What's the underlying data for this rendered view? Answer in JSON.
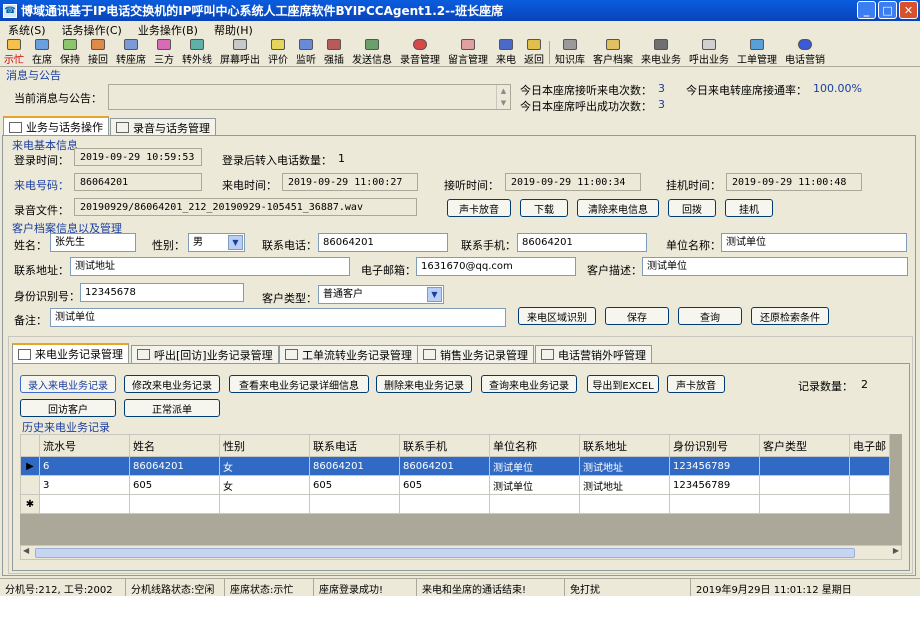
{
  "window": {
    "title": "博域通讯基于IP电话交换机的IP呼叫中心系统人工座席软件BYIPCCAgent1.2--班长座席"
  },
  "menu": [
    "系统(S)",
    "话务操作(C)",
    "业务操作(B)",
    "帮助(H)"
  ],
  "toolbar": [
    "示忙",
    "在席",
    "保持",
    "接回",
    "转座席",
    "三方",
    "转外线",
    "屏幕呼出",
    "评价",
    "监听",
    "强插",
    "发送信息",
    "录音管理",
    "留言管理",
    "来电",
    "返回",
    "知识库",
    "客户档案",
    "来电业务",
    "呼出业务",
    "工单管理",
    "电话营销"
  ],
  "notice": {
    "section_label": "消息与公告",
    "current_label": "当前消息与公告：",
    "current_value": "",
    "stats": [
      {
        "label": "今日本座席接听来电次数：",
        "value": "3"
      },
      {
        "label": "今日来电转座席接通率：",
        "value": "100.00%"
      },
      {
        "label": "今日本座席呼出成功次数：",
        "value": "3"
      }
    ]
  },
  "main_tabs": [
    "业务与话务操作",
    "录音与话务管理"
  ],
  "call_info": {
    "section_label": "来电基本信息",
    "login_time_label": "登录时间：",
    "login_time": "2019-09-29 10:59:53",
    "transfer_count_label": "登录后转入电话数量：",
    "transfer_count": "1",
    "caller_label": "来电号码：",
    "caller": "86064201",
    "incoming_time_label": "来电时间：",
    "incoming_time": "2019-09-29 11:00:27",
    "answer_time_label": "接听时间：",
    "answer_time": "2019-09-29 11:00:34",
    "hangup_time_label": "挂机时间：",
    "hangup_time": "2019-09-29 11:00:48",
    "recording_label": "录音文件：",
    "recording_file": "20190929/86064201_212_20190929-105451_36887.wav",
    "buttons": [
      "声卡放音",
      "下载",
      "清除来电信息",
      "回拨",
      "挂机"
    ]
  },
  "customer": {
    "section_label": "客户档案信息以及管理",
    "name_label": "姓名：",
    "name": "张先生",
    "gender_label": "性别：",
    "gender": "男",
    "phone_label": "联系电话：",
    "phone": "86064201",
    "mobile_label": "联系手机：",
    "mobile": "86064201",
    "company_label": "单位名称：",
    "company": "测试单位",
    "address_label": "联系地址：",
    "address": "测试地址",
    "email_label": "电子邮箱：",
    "email": "1631670@qq.com",
    "desc_label": "客户描述：",
    "desc": "测试单位",
    "id_label": "身份识别号：",
    "id_number": "12345678",
    "type_label": "客户类型：",
    "type": "普通客户",
    "remark_label": "备注：",
    "remark": "测试单位",
    "buttons": [
      "来电区域识别",
      "保存",
      "查询",
      "还原检索条件"
    ]
  },
  "biz_tabs": [
    "来电业务记录管理",
    "呼出[回访]业务记录管理",
    "工单流转业务记录管理",
    "销售业务记录管理",
    "电话营销外呼管理"
  ],
  "biz_buttons": [
    "录入来电业务记录",
    "修改来电业务记录",
    "查看来电业务记录详细信息",
    "删除来电业务记录",
    "查询来电业务记录",
    "导出到EXCEL",
    "声卡放音"
  ],
  "biz_buttons2": [
    "回访客户",
    "正常派单"
  ],
  "record_count_label": "记录数量：",
  "record_count": "2",
  "history": {
    "section_label": "历史来电业务记录",
    "columns": [
      "流水号",
      "姓名",
      "性别",
      "联系电话",
      "联系手机",
      "单位名称",
      "联系地址",
      "身份识别号",
      "客户类型",
      "电子邮"
    ],
    "rows": [
      [
        "6",
        "86064201",
        "女",
        "86064201",
        "86064201",
        "测试单位",
        "测试地址",
        "123456789",
        "",
        ""
      ],
      [
        "3",
        "605",
        "女",
        "605",
        "605",
        "测试单位",
        "测试地址",
        "123456789",
        "",
        ""
      ]
    ]
  },
  "status": [
    "分机号:212, 工号:2002",
    "分机线路状态:空闲",
    "座席状态:示忙",
    "座席登录成功!",
    "来电和坐席的通话结束!",
    "免打扰",
    "2019年9月29日  11:01:12  星期日"
  ]
}
